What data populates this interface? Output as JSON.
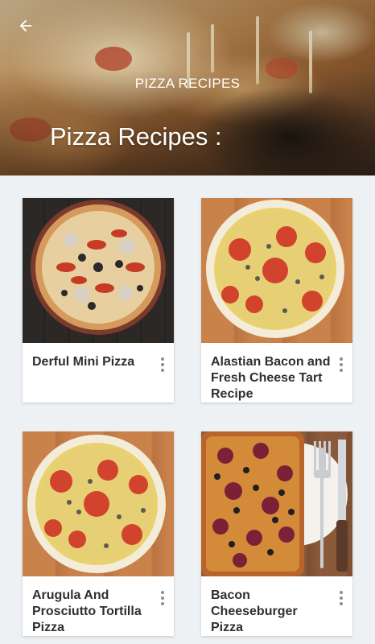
{
  "header": {
    "toolbar_title": "PIZZA RECIPES",
    "page_heading": "Pizza Recipes :",
    "back_icon": "arrow-left-icon"
  },
  "recipes": [
    {
      "title": "Derful Mini Pizza",
      "image": "pizza-pepperoni-olives-dark-wood"
    },
    {
      "title": "Alastian Bacon and Fresh Cheese Tart Recipe",
      "image": "pizza-tomato-slices-light-wood"
    },
    {
      "title": "Arugula And Prosciutto Tortilla Pizza",
      "image": "pizza-tomato-slices-light-wood"
    },
    {
      "title": "Bacon Cheeseburger Pizza",
      "image": "pizza-salami-olives-with-fork-knife"
    }
  ],
  "colors": {
    "background": "#eef1f4",
    "card": "#ffffff",
    "title_text": "#2f2f2f",
    "menu_dots": "#8e8e8e"
  }
}
